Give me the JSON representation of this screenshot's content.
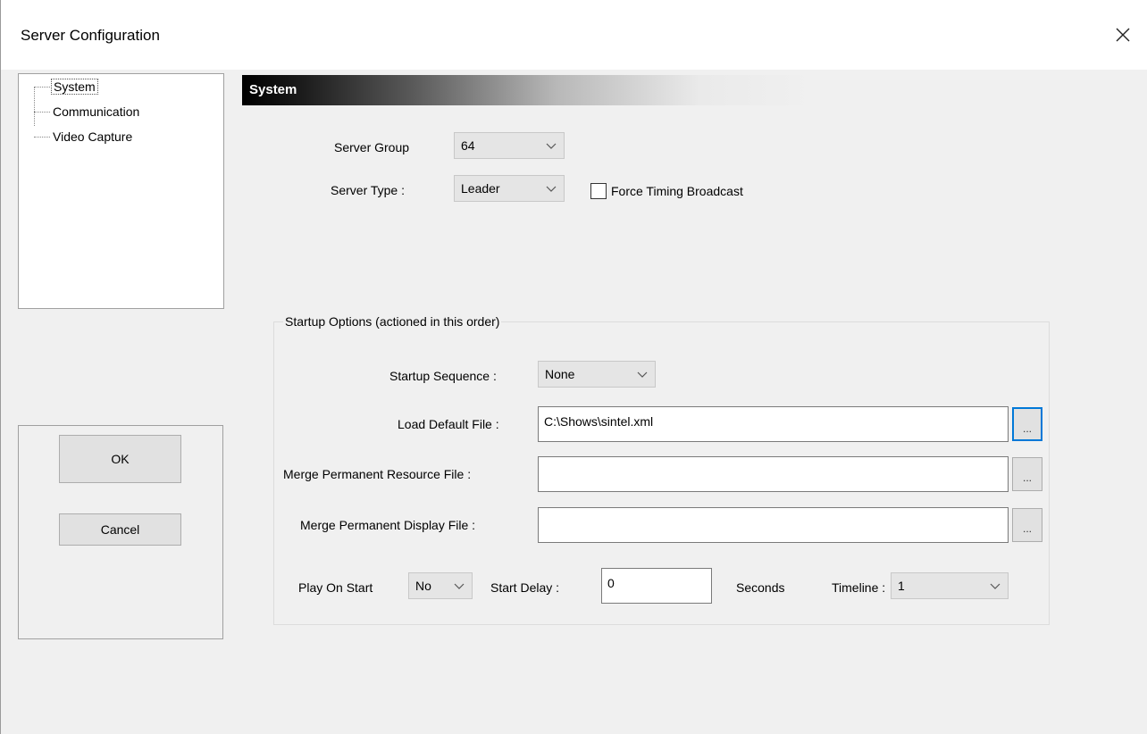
{
  "window": {
    "title": "Server Configuration"
  },
  "tree": {
    "items": [
      {
        "label": "System",
        "selected": true
      },
      {
        "label": "Communication",
        "selected": false
      },
      {
        "label": "Video Capture",
        "selected": false
      }
    ]
  },
  "section": {
    "title": "System"
  },
  "system": {
    "server_group_label": "Server Group",
    "server_group_value": "64",
    "server_type_label": "Server Type :",
    "server_type_value": "Leader",
    "force_timing_label": "Force Timing Broadcast",
    "force_timing_checked": false
  },
  "startup": {
    "group_title": "Startup Options (actioned in this order)",
    "sequence_label": "Startup Sequence :",
    "sequence_value": "None",
    "load_default_label": "Load Default File :",
    "load_default_value": "C:\\Shows\\sintel.xml",
    "merge_resource_label": "Merge Permanent Resource File :",
    "merge_resource_value": "",
    "merge_display_label": "Merge Permanent Display File :",
    "merge_display_value": "",
    "browse_label": "...",
    "play_on_start_label": "Play On Start",
    "play_on_start_value": "No",
    "start_delay_label": "Start Delay :",
    "start_delay_value": "0",
    "seconds_label": "Seconds",
    "timeline_label": "Timeline :",
    "timeline_value": "1"
  },
  "buttons": {
    "ok": "OK",
    "cancel": "Cancel"
  },
  "icons": {
    "close": "close-icon",
    "dropdown": "chevron-down-icon"
  },
  "colors": {
    "focus_accent": "#0078d7",
    "window_bg": "#f0f0f0"
  }
}
